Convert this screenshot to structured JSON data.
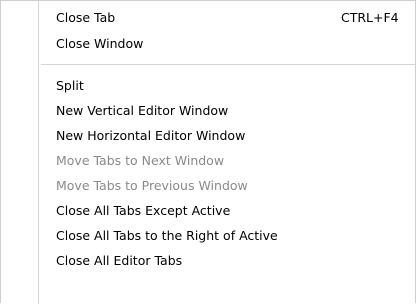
{
  "menu": {
    "group1": [
      {
        "label": "Close Tab",
        "shortcut": "CTRL+F4"
      },
      {
        "label": "Close Window"
      }
    ],
    "group2": [
      {
        "label": "Split"
      },
      {
        "label": "New Vertical Editor Window"
      },
      {
        "label": "New Horizontal Editor Window"
      },
      {
        "label": "Move Tabs to Next Window",
        "disabled": true
      },
      {
        "label": "Move Tabs to Previous Window",
        "disabled": true
      },
      {
        "label": "Close All Tabs Except Active"
      },
      {
        "label": "Close All Tabs to the Right of Active"
      },
      {
        "label": "Close All Editor Tabs"
      }
    ]
  }
}
